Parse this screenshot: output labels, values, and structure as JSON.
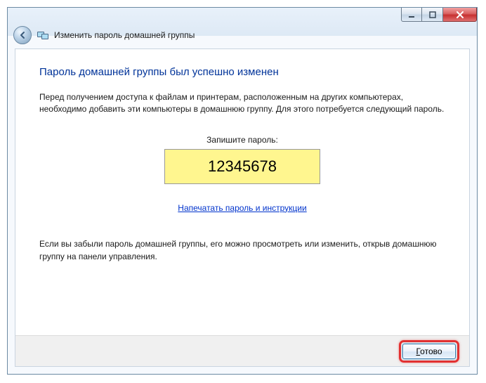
{
  "header": {
    "title": "Изменить пароль домашней группы"
  },
  "main": {
    "heading": "Пароль домашней группы был успешно изменен",
    "intro": "Перед получением доступа к файлам и принтерам, расположенным на других компьютерах, необходимо добавить эти компьютеры в домашнюю группу. Для этого потребуется следующий пароль.",
    "pw_label": "Запишите пароль:",
    "password": "12345678",
    "print_link": "Напечатать пароль и инструкции",
    "footer": "Если вы забыли пароль домашней группы, его можно просмотреть или изменить, открыв домашнюю группу на панели управления."
  },
  "buttons": {
    "done_prefix": "Г",
    "done_rest": "отово"
  }
}
